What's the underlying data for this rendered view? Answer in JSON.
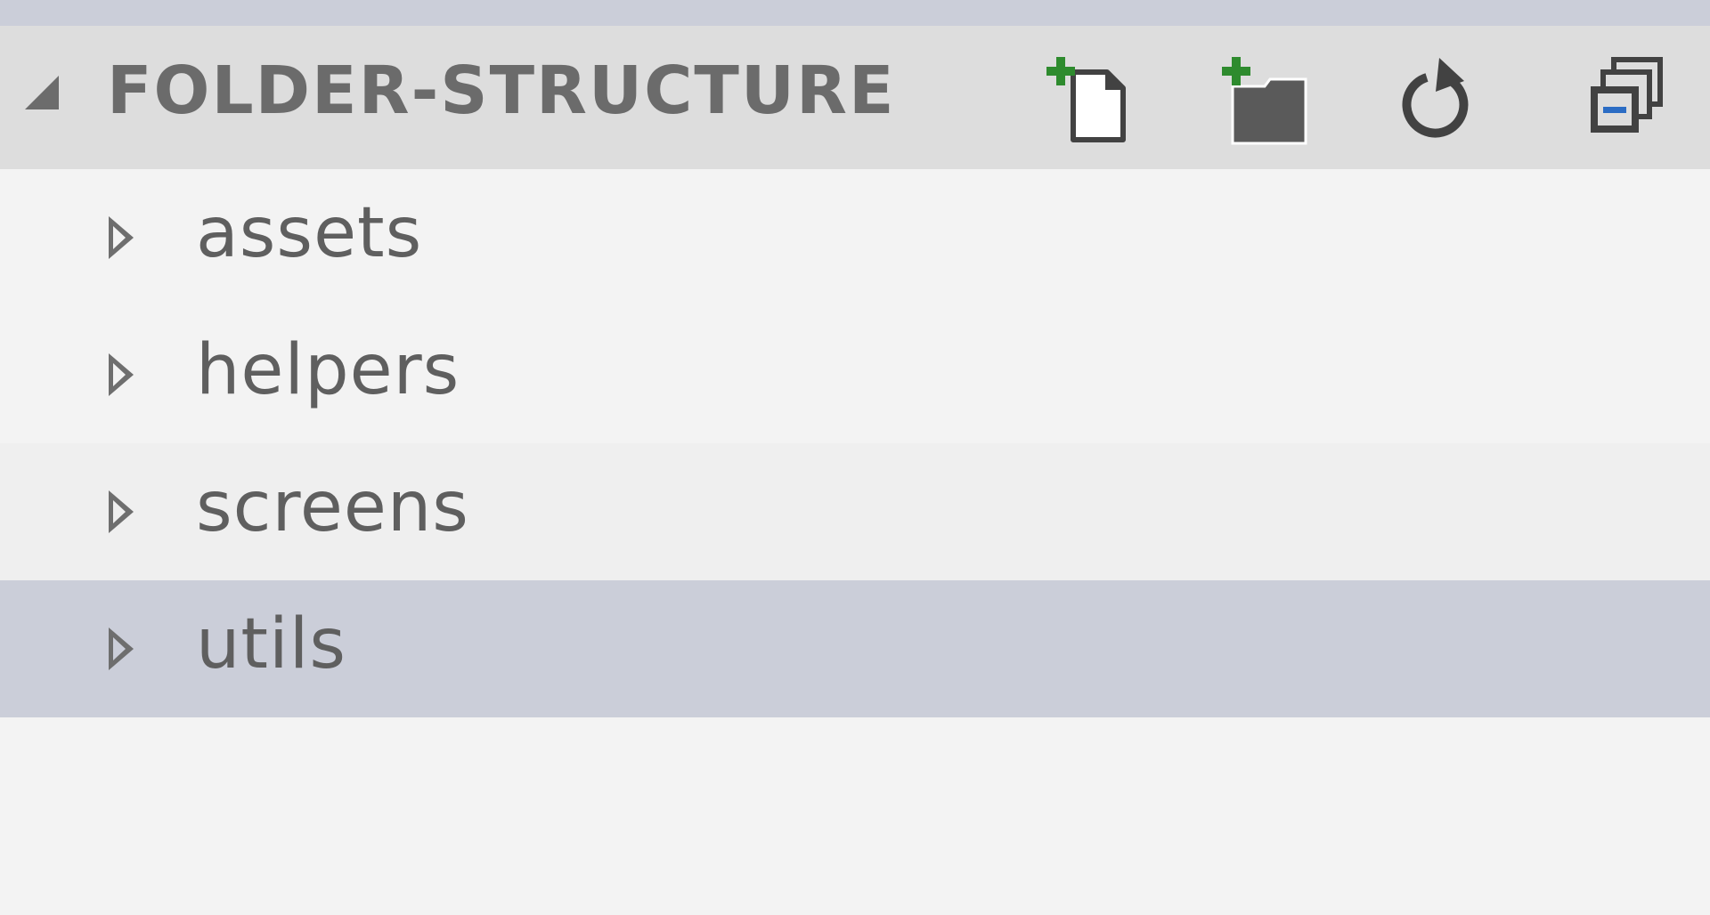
{
  "header": {
    "section_title": "FOLDER-STRUCTURE",
    "toggle_icon": "caret-down-icon",
    "actions": [
      {
        "name": "new-file",
        "icon": "new-file-icon"
      },
      {
        "name": "new-folder",
        "icon": "new-folder-icon"
      },
      {
        "name": "refresh",
        "icon": "refresh-icon"
      },
      {
        "name": "collapse-all",
        "icon": "collapse-all-icon"
      }
    ]
  },
  "tree": {
    "items": [
      {
        "label": "assets",
        "selected": false
      },
      {
        "label": "helpers",
        "selected": false
      },
      {
        "label": "screens",
        "selected": false
      },
      {
        "label": "utils",
        "selected": true
      }
    ]
  },
  "colors": {
    "header_bg": "#dddddd",
    "tree_bg": "#f3f3f3",
    "selected_bg": "#cbced9",
    "plus_green": "#2e8b2e",
    "icon_dark": "#424242",
    "text": "#5f5f5f"
  }
}
